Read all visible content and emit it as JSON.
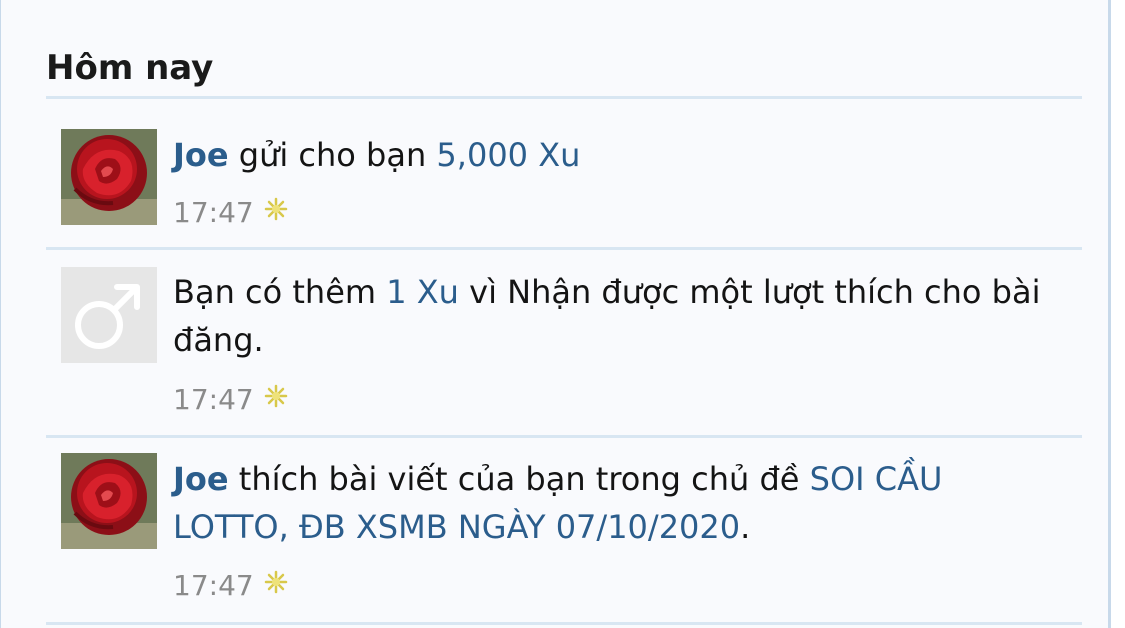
{
  "section": {
    "title": "Hôm nay"
  },
  "notifications": [
    {
      "user": "Joe",
      "text_before": " gửi cho bạn ",
      "link": "5,000 Xu",
      "text_after": "",
      "time": "17:47",
      "avatar": "rose-avatar"
    },
    {
      "text_before": "Bạn có thêm ",
      "link": "1 Xu",
      "text_after": " vì Nhận được một lượt thích cho bài đăng.",
      "time": "17:47",
      "avatar": "male-symbol-avatar"
    },
    {
      "user": "Joe",
      "text_before": " thích bài viết của bạn trong chủ đề ",
      "link": "SOI CẦU LOTTO, ĐB XSMB NGÀY 07/10/2020",
      "text_after": ".",
      "time": "17:47",
      "avatar": "rose-avatar"
    }
  ],
  "icons": {
    "new_indicator": "sparkle-icon"
  },
  "colors": {
    "link": "#2b5d8c",
    "background": "#f9fafd",
    "divider": "#d8e6f2",
    "time": "#8a8a8a",
    "sparkle": "#d8c84a"
  }
}
